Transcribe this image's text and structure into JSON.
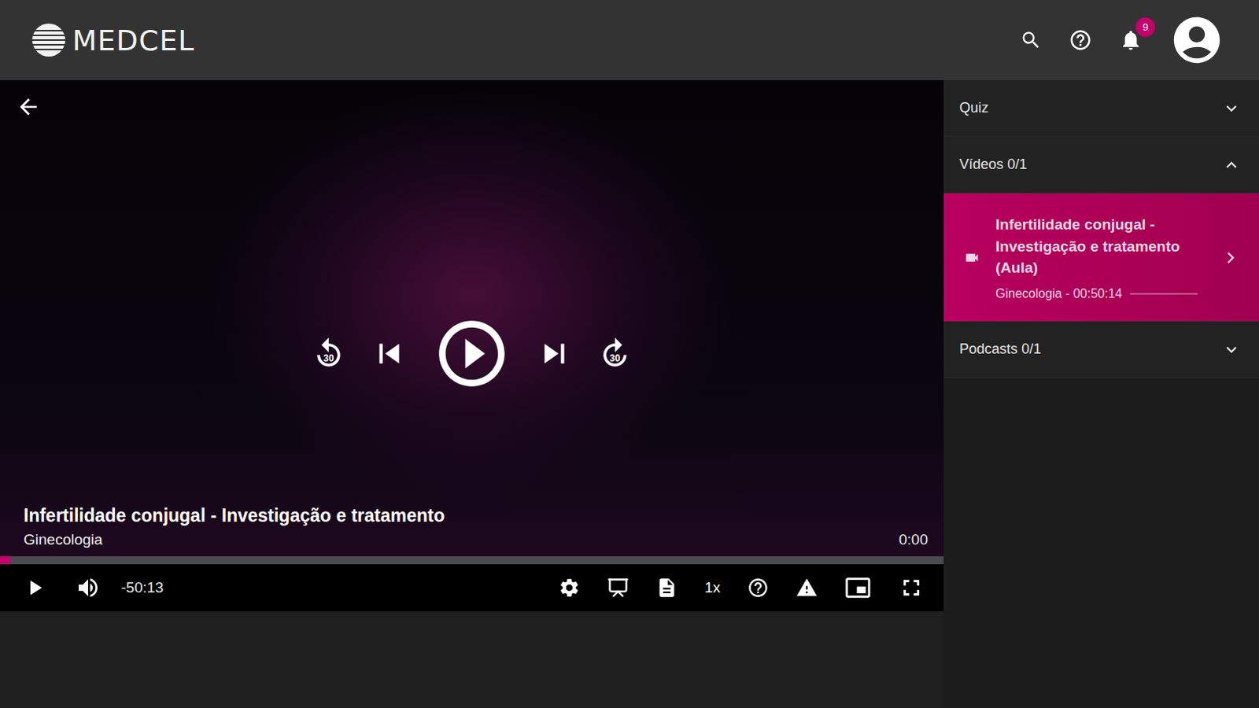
{
  "header": {
    "logo": "MEDCEL",
    "notifications": "9"
  },
  "player": {
    "title": "Infertilidade conjugal - Investigação e tratamento",
    "subtitle": "Ginecologia",
    "elapsed": "0:00",
    "remaining": "-50:13",
    "speed": "1x",
    "rewind": "30",
    "forward": "30",
    "progress": {
      "level": 0.012
    }
  },
  "sidebar": {
    "sections": [
      {
        "label": "Quiz",
        "expanded": false,
        "items": []
      },
      {
        "label": "Vídeos 0/1",
        "expanded": true,
        "items": [
          {
            "title": "Infertilidade conjugal - Investigação e tratamento (Aula)",
            "meta": "Ginecologia - 00:50:14",
            "selected": true,
            "level": 0
          }
        ]
      },
      {
        "label": "Podcasts 0/1",
        "expanded": false,
        "items": []
      }
    ]
  }
}
